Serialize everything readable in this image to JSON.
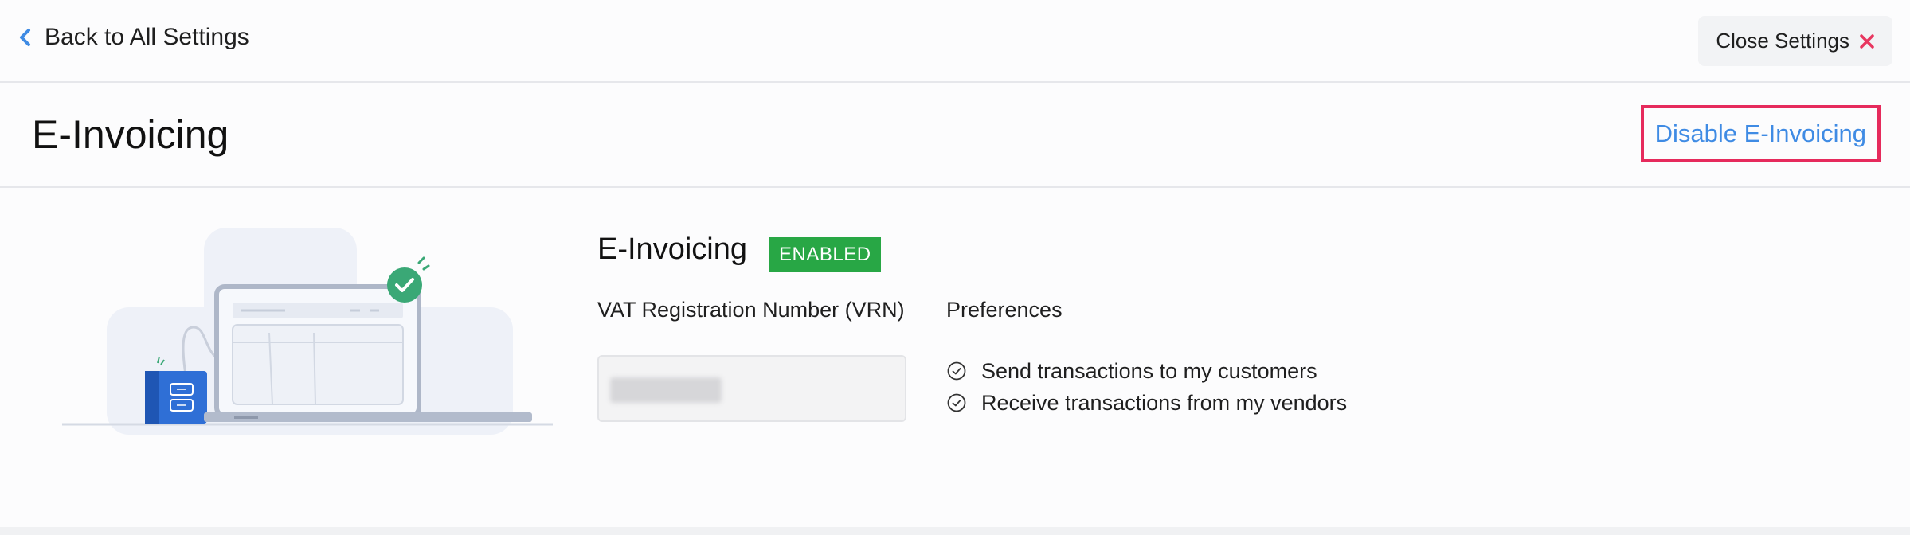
{
  "topbar": {
    "back_label": "Back to All Settings",
    "close_label": "Close Settings"
  },
  "header": {
    "title": "E-Invoicing",
    "disable_label": "Disable E-Invoicing"
  },
  "feature": {
    "title": "E-Invoicing",
    "status_badge": "ENABLED",
    "vrn_label": "VAT Registration Number (VRN)",
    "preferences_label": "Preferences",
    "preferences": [
      "Send transactions to my customers",
      "Receive transactions from my vendors"
    ]
  },
  "colors": {
    "accent_link": "#3f8be4",
    "close_icon": "#e8365f",
    "highlight_border": "#e62a5c",
    "badge_green": "#28a745"
  },
  "icons": {
    "back": "chevron-left-icon",
    "close": "close-icon",
    "check": "check-circle-icon"
  }
}
